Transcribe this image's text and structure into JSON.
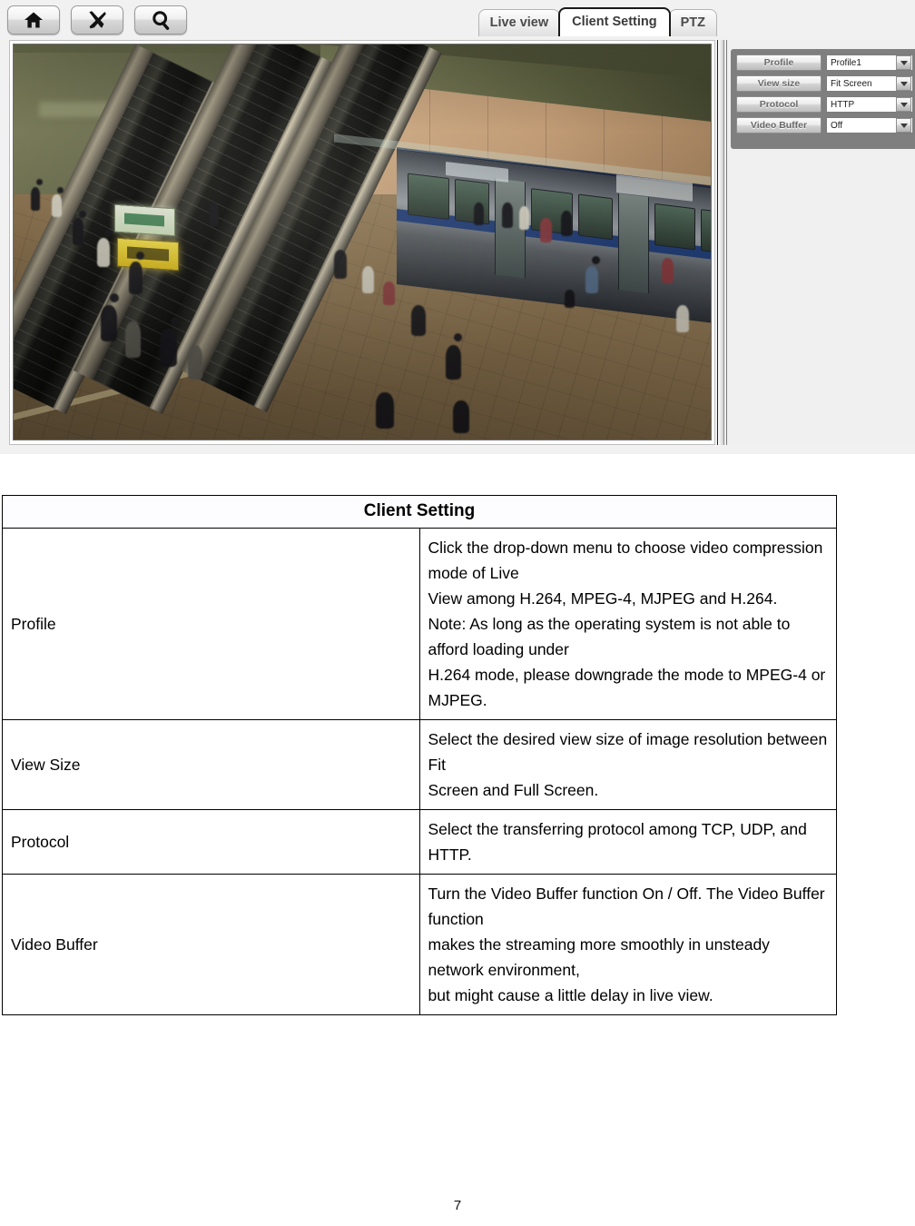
{
  "toolbar": {
    "buttons": [
      {
        "icon": "home-icon",
        "name": "home-button"
      },
      {
        "icon": "tools-icon",
        "name": "setup-button"
      },
      {
        "icon": "search-icon",
        "name": "search-button"
      }
    ]
  },
  "tabs": [
    {
      "label": "Live view",
      "active": false
    },
    {
      "label": "Client Setting",
      "active": true
    },
    {
      "label": "PTZ",
      "active": false
    }
  ],
  "viewer": {
    "alt": "Live view of a metro station platform with escalators and a train"
  },
  "settings_panel": {
    "rows": [
      {
        "label": "Profile",
        "value": "Profile1"
      },
      {
        "label": "View size",
        "value": "Fit Screen"
      },
      {
        "label": "Protocol",
        "value": "HTTP"
      },
      {
        "label": "Video Buffer",
        "value": "Off"
      }
    ]
  },
  "table": {
    "title": "Client Setting",
    "rows": [
      {
        "term": "Profile",
        "lines": [
          "Click the drop-down menu to choose video compression mode of Live",
          "View among H.264, MPEG-4, MJPEG and H.264.",
          "Note: As long as the operating system is not able to afford loading under",
          "H.264 mode, please downgrade the mode to MPEG-4 or MJPEG."
        ]
      },
      {
        "term": "View Size",
        "lines": [
          "Select the desired view size of image resolution between Fit",
          "Screen and Full Screen."
        ]
      },
      {
        "term": "Protocol",
        "lines": [
          "Select the transferring protocol among TCP, UDP, and HTTP."
        ]
      },
      {
        "term": "Video Buffer",
        "lines": [
          "Turn the Video Buffer function On / Off. The Video Buffer function",
          "makes the streaming more smoothly in unsteady network environment,",
          "but might cause a little delay in live view."
        ]
      }
    ]
  },
  "page_number": "7",
  "colors": {
    "panel_gray": "#7f7f7f",
    "tab_active_border": "#1a1a1a",
    "page_background": "#ffffff"
  }
}
